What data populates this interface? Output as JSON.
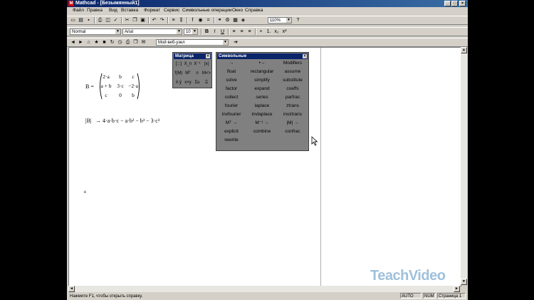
{
  "window": {
    "title": "Mathcad - [Безымянный1]"
  },
  "menu": [
    "Файл",
    "Правка",
    "Вид",
    "Вставка",
    "Формат",
    "Сервис",
    "Символьные операции",
    "Окно",
    "Справка"
  ],
  "toolbar": {
    "zoom": "110%"
  },
  "format_bar": {
    "style": "Normal",
    "font": "Arial",
    "size": "10"
  },
  "web_bar": {
    "url": "Мой веб-узел"
  },
  "worksheet": {
    "def_lhs": "B =",
    "matrix": [
      [
        "2·a",
        "b",
        "c"
      ],
      [
        "a + b",
        "3·c",
        "−2·a"
      ],
      [
        "c",
        "0",
        "b"
      ]
    ],
    "det_lhs": "|B|",
    "det_arrow": "→",
    "det_result": "4·a·b·c − a·b² − b³ − 3·c³",
    "cursor": "+"
  },
  "matrix_palette": {
    "title": "Матрица",
    "buttons": [
      "[:::]",
      "X_n",
      "X⁻¹",
      "|x|",
      "f(M)",
      "Mᵀ",
      "n",
      "M<>",
      "x̄·ȳ",
      "x×y",
      "Σu",
      "⌹"
    ]
  },
  "symbolic_palette": {
    "title": "Символьные",
    "keywords": [
      [
        "→",
        "•→",
        "Modifiers"
      ],
      [
        "float",
        "rectangular",
        "assume"
      ],
      [
        "solve",
        "simplify",
        "substitute"
      ],
      [
        "factor",
        "expand",
        "coeffs"
      ],
      [
        "collect",
        "series",
        "parfrac"
      ],
      [
        "fourier",
        "laplace",
        "ztrans"
      ],
      [
        "invfourier",
        "invlaplace",
        "invztrans"
      ],
      [
        "Mᵀ →",
        "M⁻¹ →",
        "|M| →"
      ],
      [
        "explicit",
        "combine",
        "confrac"
      ],
      [
        "rewrite",
        "",
        ""
      ]
    ]
  },
  "status": {
    "hint": "Нажмите F1, чтобы открыть справку.",
    "mode": "AUTO",
    "num": "NUM",
    "page": "Страница 1"
  },
  "watermark": "TeachVideo"
}
